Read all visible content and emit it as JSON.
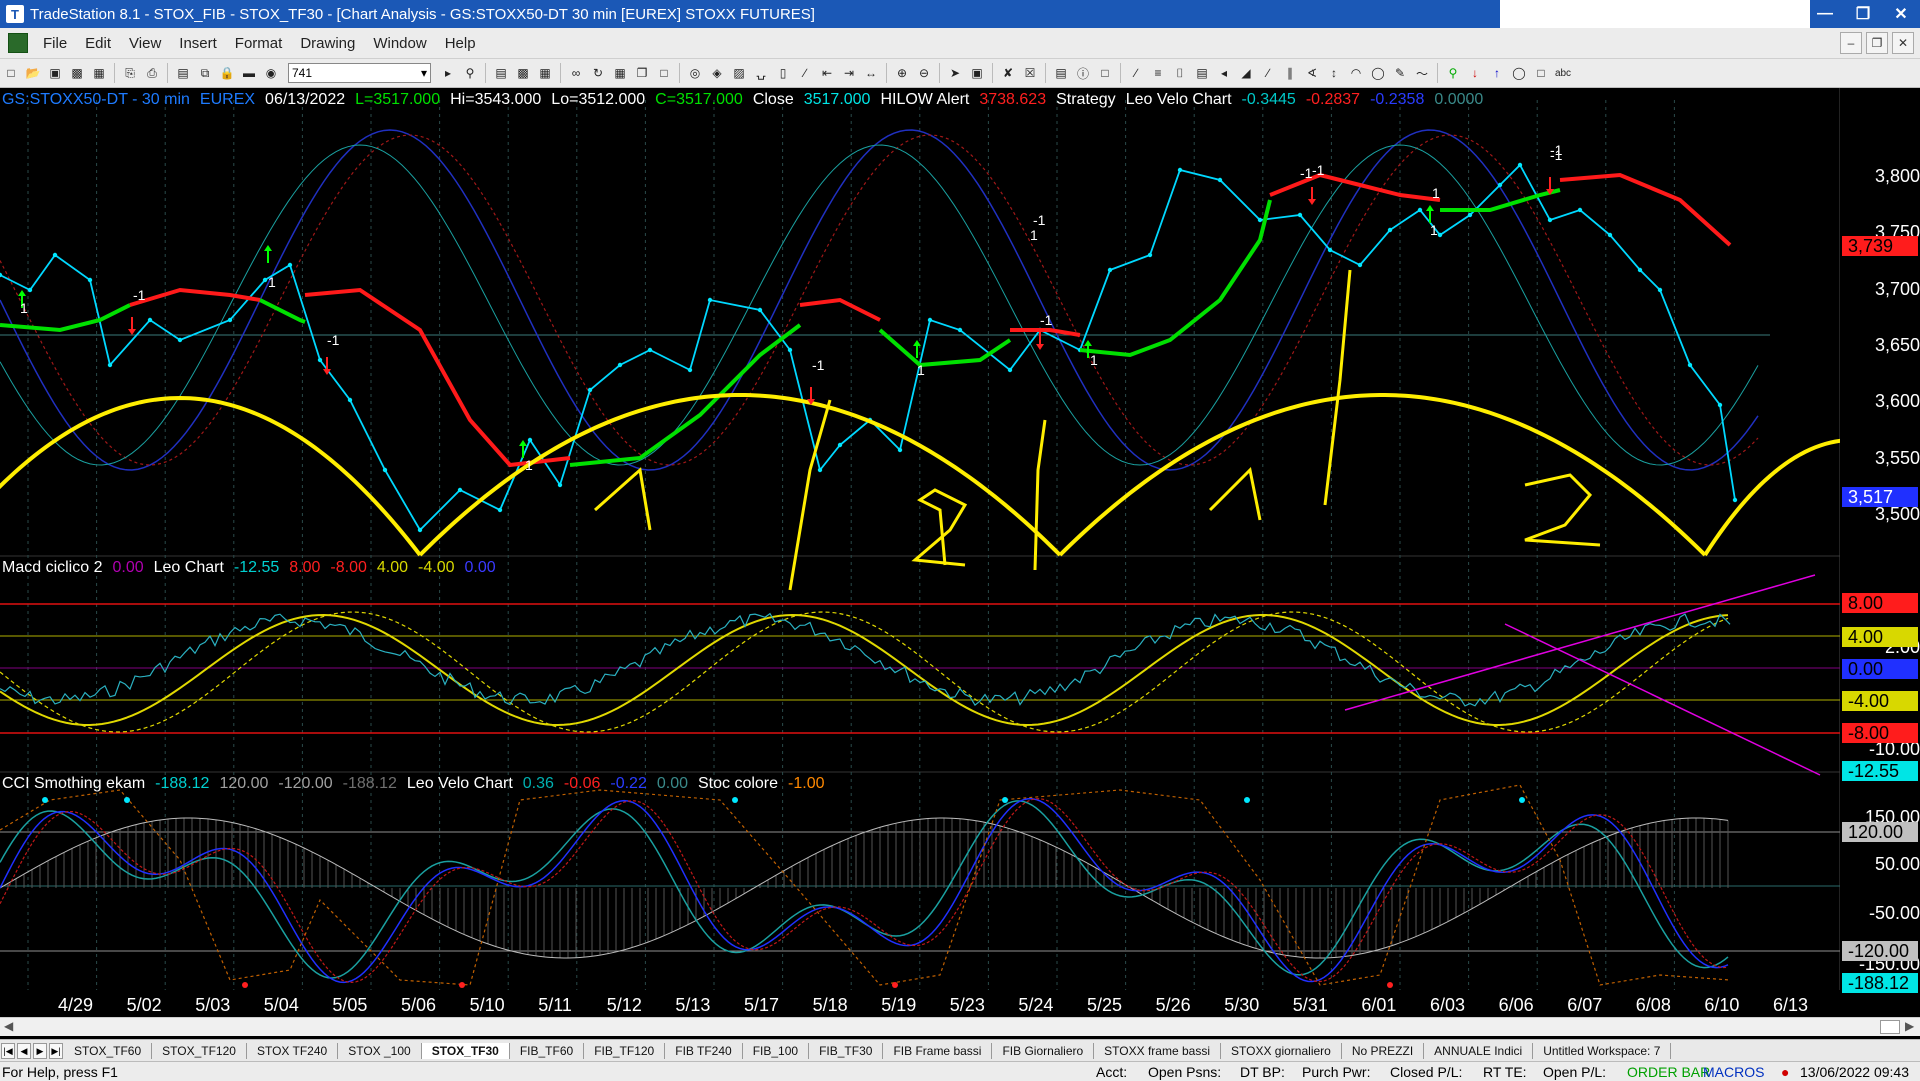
{
  "window": {
    "title": "TradeStation 8.1 - STOX_FIB - STOX_TF30 - [Chart Analysis - GS:STOXX50-DT  30 min  [EUREX] STOXX FUTURES]"
  },
  "menu": [
    "File",
    "Edit",
    "View",
    "Insert",
    "Format",
    "Drawing",
    "Window",
    "Help"
  ],
  "toolbar": {
    "combo_value": "741"
  },
  "main_header": [
    {
      "text": "GS:STOXX50-DT - 30 min",
      "color": "#1e7bff"
    },
    {
      "text": "EUREX",
      "color": "#1e7bff"
    },
    {
      "text": "06/13/2022",
      "color": "#ffffff"
    },
    {
      "text": "L=3517.000",
      "color": "#00e000"
    },
    {
      "text": "Hi=3543.000",
      "color": "#ffffff"
    },
    {
      "text": "Lo=3512.000",
      "color": "#ffffff"
    },
    {
      "text": "C=3517.000",
      "color": "#00e000"
    },
    {
      "text": "Close",
      "color": "#ffffff"
    },
    {
      "text": "3517.000",
      "color": "#00e5e5"
    },
    {
      "text": "HILOW Alert",
      "color": "#ffffff"
    },
    {
      "text": "3738.623",
      "color": "#ff2020"
    },
    {
      "text": "Strategy",
      "color": "#ffffff"
    },
    {
      "text": "Leo Velo Chart",
      "color": "#ffffff"
    },
    {
      "text": "-0.3445",
      "color": "#00c8c8"
    },
    {
      "text": "-0.2837",
      "color": "#ff2020"
    },
    {
      "text": "-0.2358",
      "color": "#2a3cff"
    },
    {
      "text": "0.0000",
      "color": "#3a8a8a"
    }
  ],
  "macd_header": [
    {
      "text": "Macd ciclico 2",
      "color": "#ffffff"
    },
    {
      "text": "0.00",
      "color": "#b000b0"
    },
    {
      "text": "Leo Chart",
      "color": "#ffffff"
    },
    {
      "text": "-12.55",
      "color": "#00d0d0"
    },
    {
      "text": "8.00",
      "color": "#ff2020"
    },
    {
      "text": "-8.00",
      "color": "#ff2020"
    },
    {
      "text": "4.00",
      "color": "#d8d800"
    },
    {
      "text": "-4.00",
      "color": "#d8d800"
    },
    {
      "text": "0.00",
      "color": "#3a3aff"
    }
  ],
  "cci_header": [
    {
      "text": "CCI Smothing ekam",
      "color": "#ffffff"
    },
    {
      "text": "-188.12",
      "color": "#00d0d0"
    },
    {
      "text": "120.00",
      "color": "#a0a0a0"
    },
    {
      "text": "-120.00",
      "color": "#a0a0a0"
    },
    {
      "text": "-188.12",
      "color": "#707070"
    },
    {
      "text": "Leo Velo Chart",
      "color": "#ffffff"
    },
    {
      "text": "0.36",
      "color": "#00b0b0"
    },
    {
      "text": "-0.06",
      "color": "#ff2020"
    },
    {
      "text": "-0.22",
      "color": "#2a3cff"
    },
    {
      "text": "0.00",
      "color": "#3a8a8a"
    },
    {
      "text": "Stoc colore",
      "color": "#ffffff"
    },
    {
      "text": "-1.00",
      "color": "#ff8800"
    }
  ],
  "price_axis": [
    "3,800",
    "3,750",
    "3,700",
    "3,650",
    "3,600",
    "3,550",
    "3,500"
  ],
  "price_badges": [
    {
      "text": "3,739",
      "bg": "#ff1c1c",
      "fg": "#000000"
    },
    {
      "text": "3,517",
      "bg": "#2030ff",
      "fg": "#ffffff"
    }
  ],
  "macd_axis": [
    "2.00",
    "-10.00"
  ],
  "macd_badges": [
    {
      "text": "8.00",
      "bg": "#ff1c1c",
      "fg": "#000000"
    },
    {
      "text": "4.00",
      "bg": "#d8d800",
      "fg": "#000000"
    },
    {
      "text": "0.00",
      "bg": "#2030ff",
      "fg": "#000000"
    },
    {
      "text": "-4.00",
      "bg": "#d8d800",
      "fg": "#000000"
    },
    {
      "text": "-8.00",
      "bg": "#ff1c1c",
      "fg": "#000000"
    },
    {
      "text": "-12.55",
      "bg": "#00e5e5",
      "fg": "#000000"
    }
  ],
  "cci_axis": [
    "150.00",
    "50.00",
    "-50.00",
    "-150.00"
  ],
  "cci_badges": [
    {
      "text": "120.00",
      "bg": "#c0c0c0",
      "fg": "#000000"
    },
    {
      "text": "-120.00",
      "bg": "#c0c0c0",
      "fg": "#000000"
    },
    {
      "text": "-188.12",
      "bg": "#00e5e5",
      "fg": "#000000"
    }
  ],
  "dates": [
    "4/29",
    "5/02",
    "5/03",
    "5/04",
    "5/05",
    "5/06",
    "5/10",
    "5/11",
    "5/12",
    "5/13",
    "5/17",
    "5/18",
    "5/19",
    "5/23",
    "5/24",
    "5/25",
    "5/26",
    "5/30",
    "5/31",
    "6/01",
    "6/03",
    "6/06",
    "6/07",
    "6/08",
    "6/10",
    "6/13"
  ],
  "signal_labels": [
    "1",
    "-1",
    "1",
    "-1",
    "1",
    "-1",
    "1",
    "-1",
    "1",
    "-1",
    "1",
    "-1",
    "1",
    "-1",
    "-1",
    "1",
    "-1"
  ],
  "tabs": [
    "STOX_TF60",
    "STOX_TF120",
    "STOX TF240",
    "STOX _100",
    "STOX_TF30",
    "FIB_TF60",
    "FIB_TF120",
    "FIB TF240",
    "FIB_100",
    "FIB_TF30",
    "FIB Frame bassi",
    "FIB Giornaliero",
    "STOXX frame bassi",
    "STOXX giornaliero",
    "No PREZZI",
    "ANNUALE Indici",
    "Untitled Workspace: 7"
  ],
  "active_tab": "STOX_TF30",
  "status": {
    "help": "For Help, press F1",
    "acct": "Acct:",
    "open_psns": "Open Psns:",
    "dt_bp": "DT BP:",
    "purch_pwr": "Purch Pwr:",
    "closed_pl": "Closed P/L:",
    "rt_te": "RT TE:",
    "open_pl": "Open P/L:",
    "order_bar": "ORDER BAR",
    "macros": "MACROS",
    "datetime": "13/06/2022 09:43"
  }
}
